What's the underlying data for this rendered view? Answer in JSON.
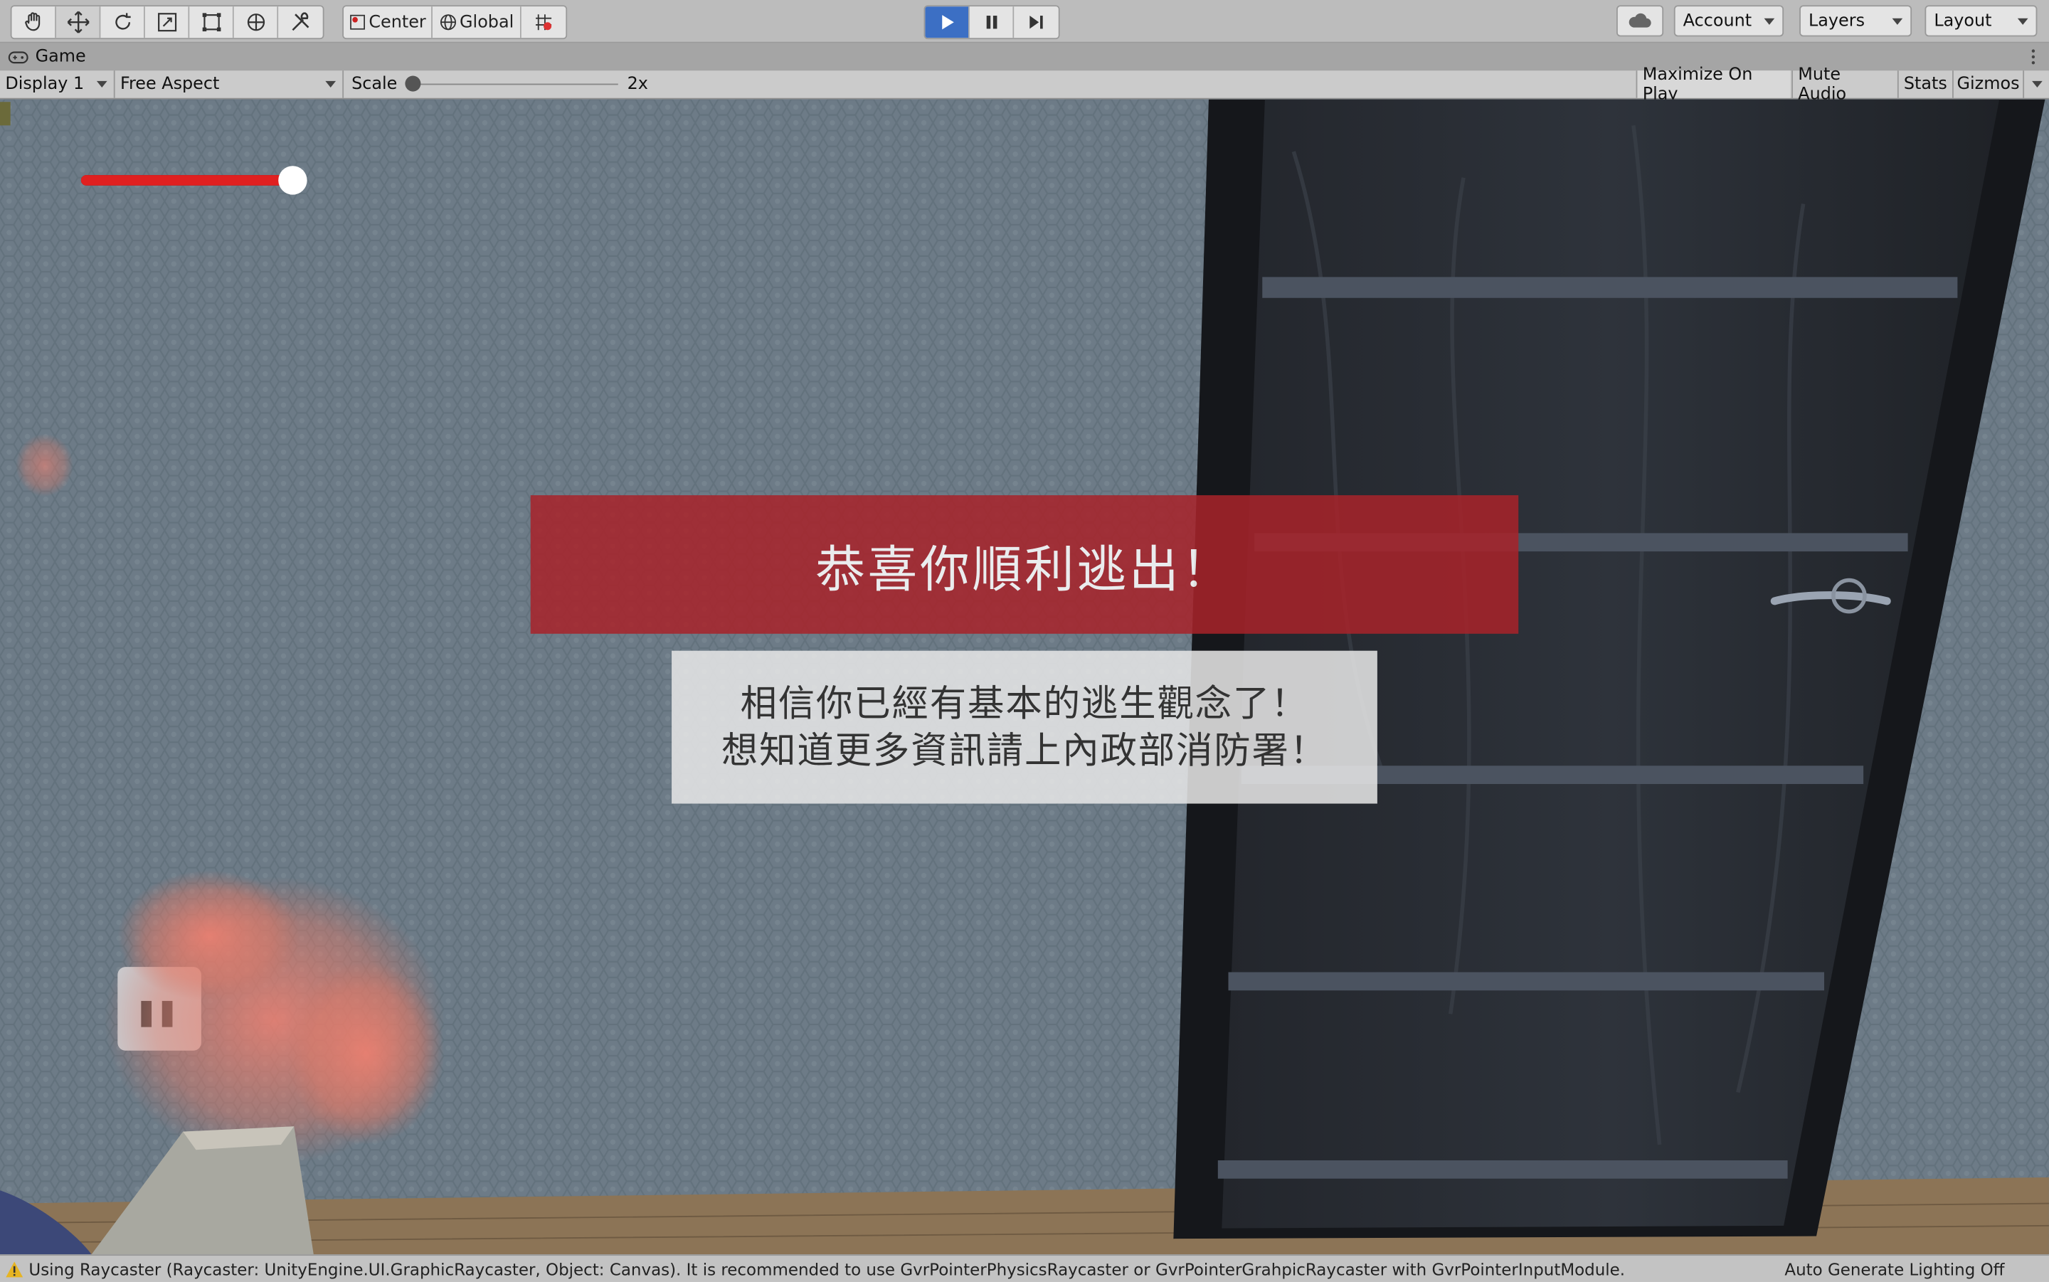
{
  "toolbar": {
    "pivot_center_label": "Center",
    "pivot_global_label": "Global",
    "account_label": "Account",
    "layers_label": "Layers",
    "layout_label": "Layout",
    "play_color": "#3c6fc4"
  },
  "tab": {
    "game_label": "Game"
  },
  "game_bar": {
    "display_label": "Display 1",
    "aspect_label": "Free Aspect",
    "scale_label": "Scale",
    "scale_value": "2x",
    "maximize_label": "Maximize On Play",
    "mute_label": "Mute Audio",
    "stats_label": "Stats",
    "gizmos_label": "Gizmos"
  },
  "scene": {
    "health_level": 1.0,
    "health_color": "#e02020",
    "banner_title": "恭喜你順利逃出！",
    "banner_color": "#a8232a",
    "message_line1": "相信你已經有基本的逃生觀念了！",
    "message_line2": "想知道更多資訊請上內政部消防署！"
  },
  "status": {
    "warning_text": "Using Raycaster (Raycaster: UnityEngine.UI.GraphicRaycaster, Object: Canvas). It is recommended to use GvrPointerPhysicsRaycaster or GvrPointerGrahpicRaycaster with GvrPointerInputModule.",
    "lighting_text": "Auto Generate Lighting Off"
  }
}
